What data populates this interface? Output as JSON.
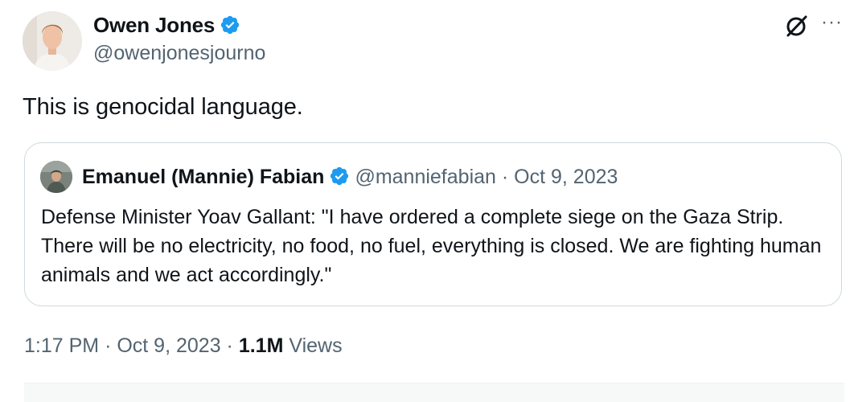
{
  "tweet": {
    "author": {
      "name": "Owen Jones",
      "handle": "@owenjonesjourno",
      "verified": true
    },
    "text": "This is genocidal language.",
    "time": "1:17 PM",
    "date": "Oct 9, 2023",
    "views_count": "1.1M",
    "views_label": "Views",
    "separator": "·"
  },
  "quoted_tweet": {
    "author": {
      "name": "Emanuel (Mannie) Fabian",
      "handle": "@manniefabian",
      "verified": true
    },
    "separator": "·",
    "date": "Oct 9, 2023",
    "text": "Defense Minister Yoav Gallant: \"I have ordered a complete siege on the Gaza Strip. There will be no electricity, no food, no fuel, everything is closed. We are fighting human animals and we act accordingly.\""
  },
  "icons": {
    "grok": "grok-icon",
    "more": "more-options-icon",
    "verified": "verified-badge-icon"
  },
  "colors": {
    "verified_blue": "#1d9bf0",
    "secondary_text": "#536471",
    "primary_text": "#0f1419",
    "border": "#cfd9de"
  }
}
